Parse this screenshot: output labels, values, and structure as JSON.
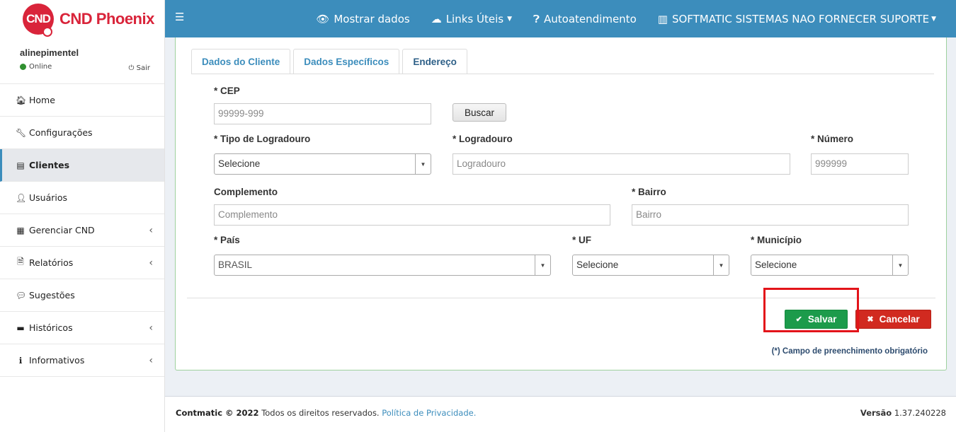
{
  "brand": {
    "logo_mark": "CND",
    "name": "CND Phoenix"
  },
  "user": {
    "name": "alinepimentel",
    "status": "Online",
    "logout": "Sair"
  },
  "sidebar": {
    "items": [
      {
        "label": "Home",
        "icon": "home-icon",
        "glyph": "🏠︎"
      },
      {
        "label": "Configurações",
        "icon": "wrench-icon",
        "glyph": "🔧︎"
      },
      {
        "label": "Clientes",
        "icon": "building-icon",
        "glyph": "▤"
      },
      {
        "label": "Usuários",
        "icon": "user-icon",
        "glyph": "👤︎"
      },
      {
        "label": "Gerenciar CND",
        "icon": "calendar-icon",
        "glyph": "▦"
      },
      {
        "label": "Relatórios",
        "icon": "file-icon",
        "glyph": "🗎"
      },
      {
        "label": "Sugestões",
        "icon": "comments-icon",
        "glyph": "💬︎"
      },
      {
        "label": "Históricos",
        "icon": "archive-icon",
        "glyph": "▬"
      },
      {
        "label": "Informativos",
        "icon": "info-icon",
        "glyph": "ℹ"
      }
    ]
  },
  "topnav": {
    "mostrar": "Mostrar dados",
    "links": "Links Úteis",
    "auto": "Autoatendimento",
    "company": "SOFTMATIC SISTEMAS NAO FORNECER SUPORTE"
  },
  "tabs": [
    "Dados do Cliente",
    "Dados Específicos",
    "Endereço"
  ],
  "form": {
    "cep": {
      "label": "* CEP",
      "placeholder": "99999-999"
    },
    "buscar": "Buscar",
    "tipo_logradouro": {
      "label": "* Tipo de Logradouro",
      "value": "Selecione"
    },
    "logradouro": {
      "label": "* Logradouro",
      "placeholder": "Logradouro"
    },
    "numero": {
      "label": "* Número",
      "placeholder": "999999"
    },
    "complemento": {
      "label": "Complemento",
      "placeholder": "Complemento"
    },
    "bairro": {
      "label": "* Bairro",
      "placeholder": "Bairro"
    },
    "pais": {
      "label": "* País",
      "value": "BRASIL"
    },
    "uf": {
      "label": "* UF",
      "value": "Selecione"
    },
    "municipio": {
      "label": "* Município",
      "value": "Selecione"
    }
  },
  "actions": {
    "save": "Salvar",
    "cancel": "Cancelar",
    "required_note": "(*) Campo de preenchimento obrigatório"
  },
  "footer": {
    "copyright_brand": "Contmatic © 2022",
    "copyright_text": " Todos os direitos reservados. ",
    "privacy": "Política de Privacidade.",
    "version_label": "Versão",
    "version": " 1.37.240228"
  },
  "colors": {
    "primary": "#3c8dbc",
    "brand_red": "#d9243a",
    "save": "#1c9b4b",
    "cancel": "#d12a20",
    "highlight": "#e3141a"
  }
}
